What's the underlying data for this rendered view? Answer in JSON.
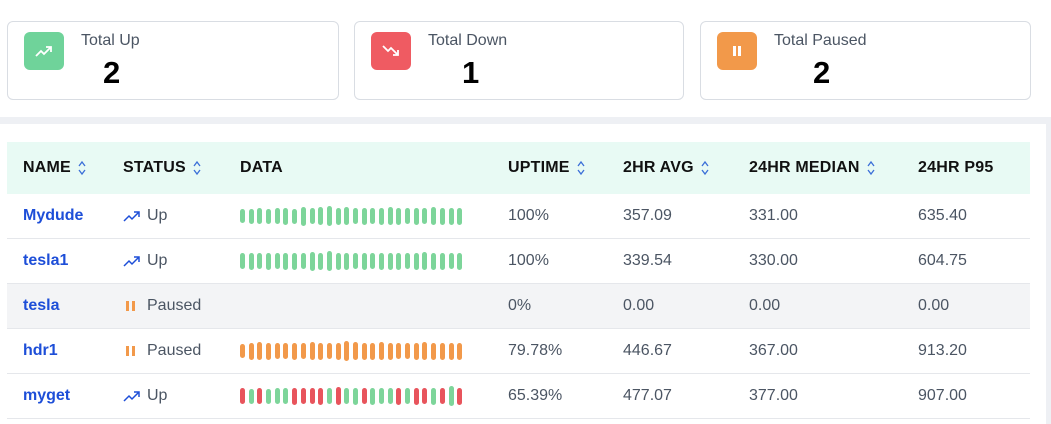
{
  "summary": {
    "up": {
      "label": "Total Up",
      "count": "2",
      "color": "#6fd39a",
      "icon": "trending-up-icon"
    },
    "down": {
      "label": "Total Down",
      "count": "1",
      "color": "#ef5b62",
      "icon": "trending-down-icon"
    },
    "paused": {
      "label": "Total Paused",
      "count": "2",
      "color": "#f2994a",
      "icon": "pause-icon"
    }
  },
  "table": {
    "headers": {
      "name": "NAME",
      "status": "STATUS",
      "data": "DATA",
      "uptime": "UPTIME",
      "avg2hr": "2HR AVG",
      "median24hr": "24HR MEDIAN",
      "p95": "24HR P95"
    },
    "rows": [
      {
        "name": "Mydude",
        "status": "Up",
        "status_icon": "trending-up-icon",
        "uptime": "100%",
        "avg2hr": "357.09",
        "median24hr": "331.00",
        "p95": "635.40",
        "bars": "gggggggggggggggggggggggggg",
        "heights": [
          0.7,
          0.75,
          0.8,
          0.75,
          0.8,
          0.85,
          0.75,
          0.95,
          0.8,
          0.9,
          1.0,
          0.85,
          0.9,
          0.8,
          0.85,
          0.8,
          0.85,
          0.9,
          0.85,
          0.8,
          0.85,
          0.8,
          0.9,
          0.85,
          0.85,
          0.85
        ]
      },
      {
        "name": "tesla1",
        "status": "Up",
        "status_icon": "trending-up-icon",
        "uptime": "100%",
        "avg2hr": "339.54",
        "median24hr": "330.00",
        "p95": "604.75",
        "bars": "gggggggggggggggggggggggggg",
        "heights": [
          0.8,
          0.85,
          0.8,
          0.85,
          0.8,
          0.85,
          0.85,
          0.8,
          0.95,
          0.85,
          1.0,
          0.85,
          0.85,
          0.8,
          0.85,
          0.8,
          0.85,
          0.85,
          0.85,
          0.8,
          0.85,
          0.9,
          0.85,
          0.85,
          0.8,
          0.85
        ]
      },
      {
        "name": "tesla",
        "status": "Paused",
        "status_icon": "pause-icon",
        "uptime": "0%",
        "avg2hr": "0.00",
        "median24hr": "0.00",
        "p95": "0.00",
        "bars": "",
        "heights": []
      },
      {
        "name": "hdr1",
        "status": "Paused",
        "status_icon": "pause-icon",
        "uptime": "79.78%",
        "avg2hr": "446.67",
        "median24hr": "367.00",
        "p95": "913.20",
        "bars": "oooooooooooooooooooooooooo",
        "heights": [
          0.7,
          0.85,
          0.9,
          0.85,
          0.8,
          0.8,
          0.85,
          0.8,
          0.9,
          0.85,
          0.8,
          0.85,
          1.0,
          0.9,
          0.85,
          0.85,
          0.9,
          0.85,
          0.8,
          0.8,
          0.85,
          0.9,
          0.85,
          0.85,
          0.85,
          0.85
        ]
      },
      {
        "name": "myget",
        "status": "Up",
        "status_icon": "trending-up-icon",
        "uptime": "65.39%",
        "avg2hr": "477.07",
        "median24hr": "377.00",
        "p95": "907.00",
        "bars": "rgrgggrrrrgrggrgggrgrrgrgr",
        "heights": [
          0.8,
          0.75,
          0.8,
          0.75,
          0.8,
          0.8,
          0.85,
          0.8,
          0.8,
          0.85,
          0.8,
          0.9,
          0.8,
          0.85,
          0.8,
          0.85,
          0.8,
          0.8,
          0.85,
          0.8,
          0.85,
          0.8,
          0.85,
          0.8,
          1.0,
          0.85
        ]
      }
    ]
  },
  "colors": {
    "green": "#7dd59a",
    "red": "#e8545c",
    "orange": "#f2994a",
    "link": "#1d4ed8",
    "header_bg": "#e8faf4"
  }
}
